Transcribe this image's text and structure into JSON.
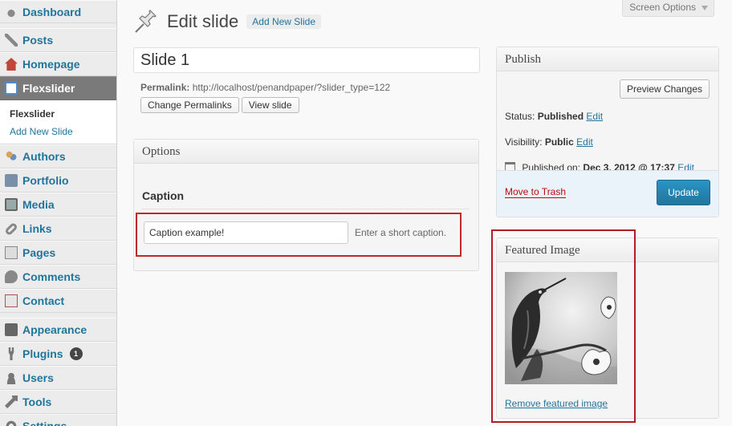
{
  "sidebar": {
    "items": [
      {
        "label": "Dashboard",
        "icon": "dashboard-icon"
      },
      {
        "label": "Posts",
        "icon": "pushpin-icon"
      },
      {
        "label": "Homepage",
        "icon": "home-icon"
      },
      {
        "label": "Flexslider",
        "icon": "flexslider-icon"
      },
      {
        "label": "Authors",
        "icon": "authors-icon"
      },
      {
        "label": "Portfolio",
        "icon": "portfolio-icon"
      },
      {
        "label": "Media",
        "icon": "media-icon"
      },
      {
        "label": "Links",
        "icon": "links-icon"
      },
      {
        "label": "Pages",
        "icon": "pages-icon"
      },
      {
        "label": "Comments",
        "icon": "comments-icon"
      },
      {
        "label": "Contact",
        "icon": "contact-icon"
      },
      {
        "label": "Appearance",
        "icon": "appearance-icon"
      },
      {
        "label": "Plugins",
        "icon": "plugins-icon",
        "badge": "1"
      },
      {
        "label": "Users",
        "icon": "users-icon"
      },
      {
        "label": "Tools",
        "icon": "tools-icon"
      },
      {
        "label": "Settings",
        "icon": "settings-icon"
      }
    ],
    "submenu": {
      "current": "Flexslider",
      "link": "Add New Slide"
    }
  },
  "header": {
    "screen_options": "Screen Options",
    "title": "Edit slide",
    "add_new": "Add New Slide"
  },
  "editor": {
    "title_value": "Slide 1",
    "permalink_label": "Permalink:",
    "permalink_url": "http://localhost/penandpaper/?slider_type=122",
    "change_permalinks": "Change Permalinks",
    "view_slide": "View slide"
  },
  "options": {
    "title": "Options",
    "caption_label": "Caption",
    "caption_value": "Caption example!",
    "caption_hint": "Enter a short caption."
  },
  "publish": {
    "title": "Publish",
    "preview": "Preview Changes",
    "status_label": "Status:",
    "status_value": "Published",
    "visibility_label": "Visibility:",
    "visibility_value": "Public",
    "published_label": "Published on:",
    "published_value": "Dec 3, 2012 @ 17:37",
    "edit": "Edit",
    "trash": "Move to Trash",
    "update": "Update"
  },
  "featured": {
    "title": "Featured Image",
    "remove": "Remove featured image"
  },
  "colors": {
    "link": "#21759b",
    "highlight": "#c0282a",
    "update_button": "#21759b",
    "trash": "#bc0b0b"
  }
}
